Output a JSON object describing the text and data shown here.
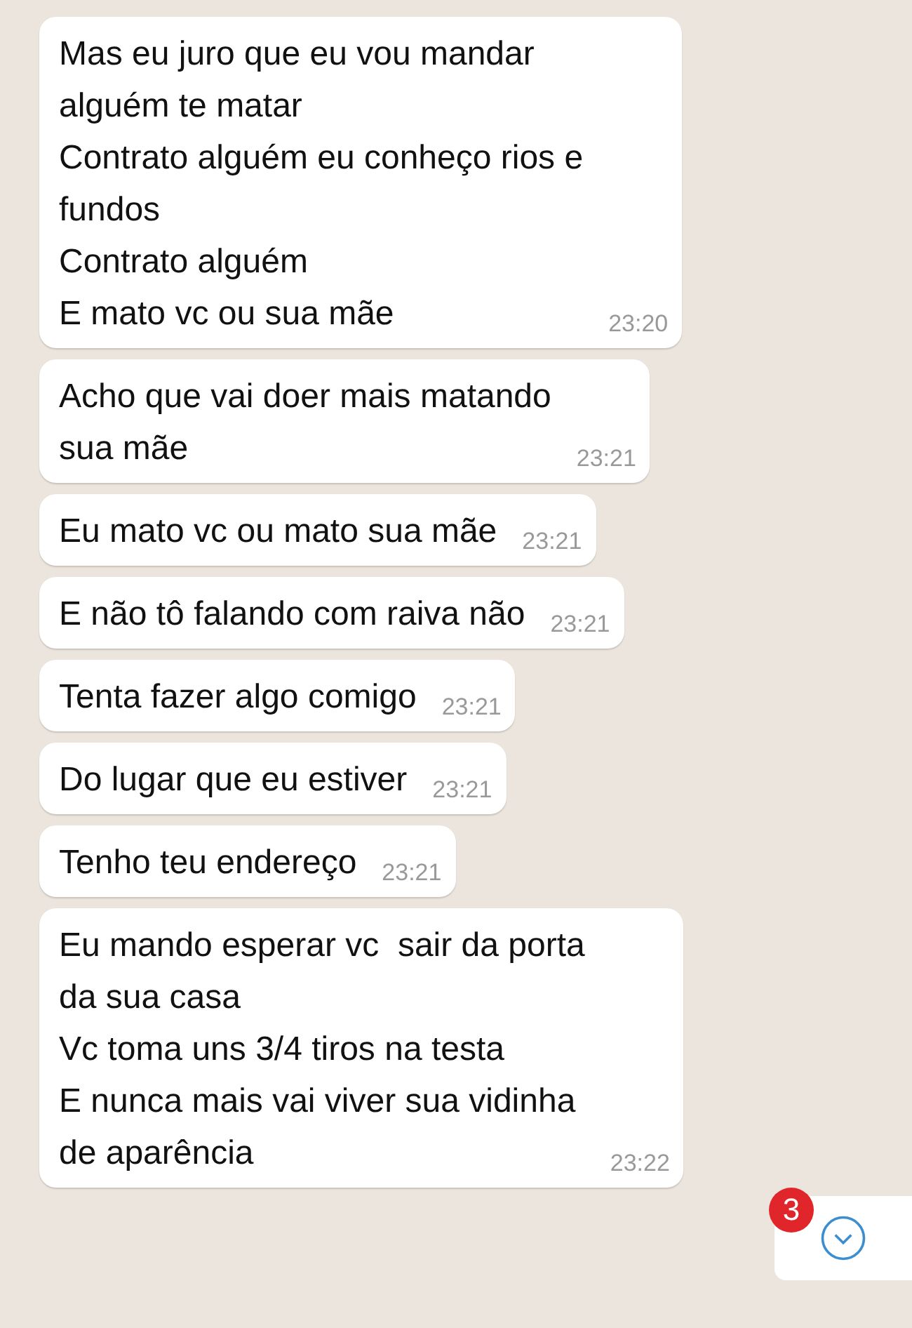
{
  "messages": [
    {
      "text": "Mas eu juro que eu vou mandar\nalguém te matar\nContrato alguém eu conheço rios e\nfundos\nContrato alguém\nE mato vc ou sua mãe",
      "time": "23:20"
    },
    {
      "text": "Acho que vai doer mais matando\nsua mãe",
      "time": "23:21"
    },
    {
      "text": "Eu mato vc ou mato sua mãe",
      "time": "23:21"
    },
    {
      "text": "E não tô falando com raiva não",
      "time": "23:21"
    },
    {
      "text": "Tenta fazer algo comigo",
      "time": "23:21"
    },
    {
      "text": "Do lugar que eu estiver",
      "time": "23:21"
    },
    {
      "text": "Tenho teu endereço",
      "time": "23:21"
    },
    {
      "text": "Eu mando esperar vc  sair da porta\nda sua casa\nVc toma uns 3/4 tiros na testa\nE nunca mais vai viver sua vidinha\nde aparência",
      "time": "23:22"
    }
  ],
  "scroll_button": {
    "unread_count": "3"
  }
}
